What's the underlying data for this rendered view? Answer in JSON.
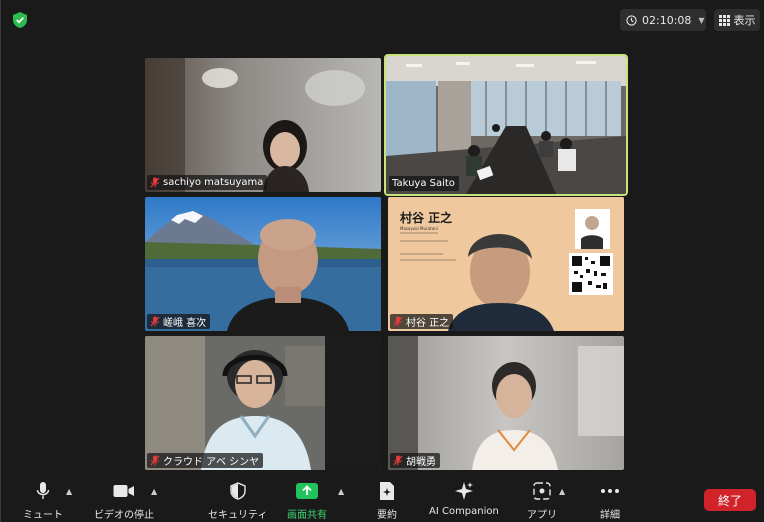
{
  "meeting": {
    "elapsed_time": "02:10:08",
    "view_label": "表示"
  },
  "participants": [
    {
      "name": "sachiyo matsuyama",
      "muted": true
    },
    {
      "name": "Takuya Saito",
      "muted": false,
      "active_speaker": true
    },
    {
      "name": "嵯峨 喜次",
      "muted": true
    },
    {
      "name": "村谷 正之",
      "muted": true
    },
    {
      "name": "クラウド アベ シンヤ",
      "muted": true
    },
    {
      "name": "胡戦勇",
      "muted": true
    }
  ],
  "slide": {
    "name_jp": "村谷 正之",
    "name_en": "Masayuki Muratani"
  },
  "toolbar": {
    "mute_label": "ミュート",
    "video_label": "ビデオの停止",
    "security_label": "セキュリティ",
    "share_label": "画面共有",
    "summary_label": "要約",
    "ai_label": "AI Companion",
    "apps_label": "アプリ",
    "more_label": "詳細",
    "end_label": "終了"
  },
  "colors": {
    "active_speaker_border": "#c9e27a",
    "share_green": "#22c35a",
    "end_red": "#d1232a"
  }
}
